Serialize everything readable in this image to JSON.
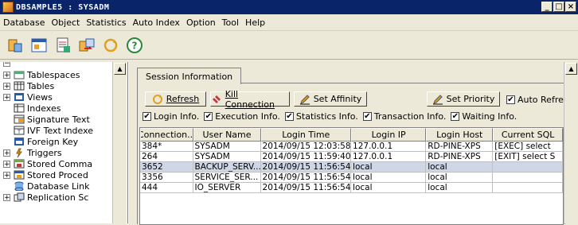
{
  "window": {
    "title": "DBSAMPLE5 : SYSADM"
  },
  "menu": [
    "Database",
    "Object",
    "Statistics",
    "Auto Index",
    "Option",
    "Tool",
    "Help"
  ],
  "toolbar_icons": [
    "connect-icon",
    "window-icon",
    "document-icon",
    "transfer-icon",
    "refresh-cycle-icon",
    "help-icon"
  ],
  "tree": [
    {
      "label": "Tablespaces",
      "icon": "tablespace-icon",
      "expander": "+"
    },
    {
      "label": "Tables",
      "icon": "table-icon",
      "expander": "+"
    },
    {
      "label": "Views",
      "icon": "view-icon",
      "expander": "+"
    },
    {
      "label": "Indexes",
      "icon": "index-icon",
      "expander": ""
    },
    {
      "label": "Signature Text",
      "icon": "signature-icon",
      "expander": ""
    },
    {
      "label": "IVF Text Indexe",
      "icon": "ivf-icon",
      "expander": ""
    },
    {
      "label": "Foreign Key",
      "icon": "foreign-key-icon",
      "expander": ""
    },
    {
      "label": "Triggers",
      "icon": "trigger-icon",
      "expander": "+"
    },
    {
      "label": "Stored Comma",
      "icon": "stored-command-icon",
      "expander": "+"
    },
    {
      "label": "Stored Proced",
      "icon": "stored-procedure-icon",
      "expander": "+"
    },
    {
      "label": "Database Link",
      "icon": "database-link-icon",
      "expander": ""
    },
    {
      "label": "Replication Sc",
      "icon": "replication-icon",
      "expander": "+"
    }
  ],
  "tab": {
    "label": "Session Information"
  },
  "buttons": {
    "refresh": "Refresh",
    "kill": "Kill Connection",
    "affinity": "Set Affinity",
    "priority": "Set Priority",
    "auto_refresh": "Auto Refresh"
  },
  "checks": [
    "Login Info.",
    "Execution Info.",
    "Statistics Info.",
    "Transaction Info.",
    "Waiting Info."
  ],
  "table": {
    "columns": [
      "Connection...",
      "User Name",
      "Login Time",
      "Login IP",
      "Login Host",
      "Current SQL"
    ],
    "rows": [
      [
        "384*",
        "SYSADM",
        "2014/09/15 12:03:58",
        "127.0.0.1",
        "RD-PINE-XPS",
        "[EXEC]  select"
      ],
      [
        "264",
        "SYSADM",
        "2014/09/15 11:59:40",
        "127.0.0.1",
        "RD-PINE-XPS",
        "[EXIT]  select S"
      ],
      [
        "3652",
        "BACKUP_SERV...",
        "2014/09/15 11:56:54",
        "local",
        "local",
        ""
      ],
      [
        "3356",
        "SERVICE_SER...",
        "2014/09/15 11:56:54",
        "local",
        "local",
        ""
      ],
      [
        "444",
        "IO_SERVER",
        "2014/09/15 11:56:54",
        "local",
        "local",
        ""
      ]
    ],
    "selected_row": 2
  }
}
